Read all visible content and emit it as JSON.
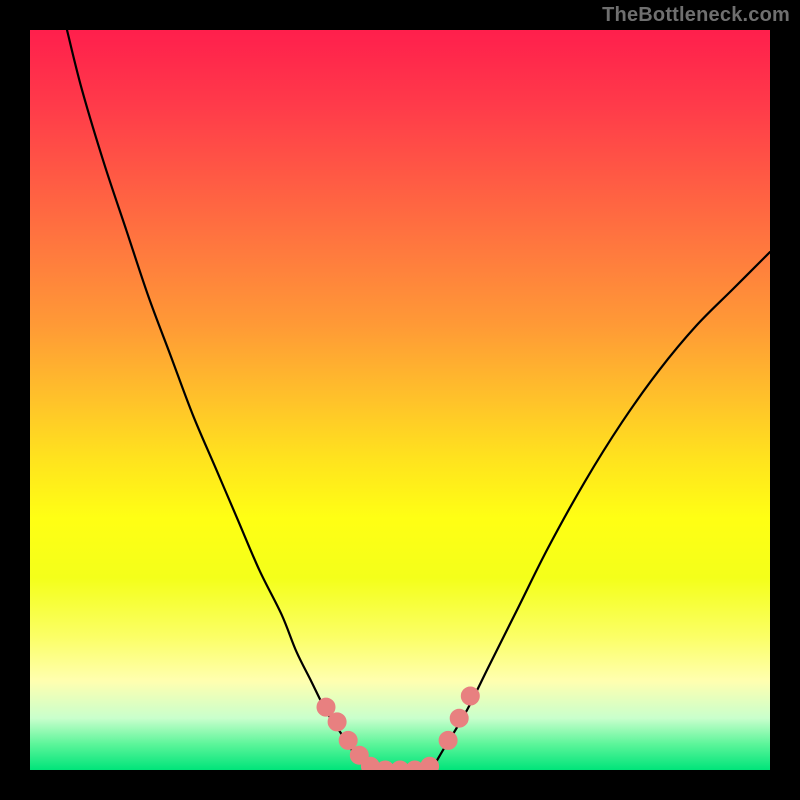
{
  "watermark": "TheBottleneck.com",
  "gradient": {
    "stops": [
      {
        "offset": 0.0,
        "color": "#ff1f4c"
      },
      {
        "offset": 0.1,
        "color": "#ff3a4a"
      },
      {
        "offset": 0.2,
        "color": "#ff5a44"
      },
      {
        "offset": 0.3,
        "color": "#ff7a3e"
      },
      {
        "offset": 0.4,
        "color": "#ff9a36"
      },
      {
        "offset": 0.5,
        "color": "#ffc22a"
      },
      {
        "offset": 0.58,
        "color": "#ffe31e"
      },
      {
        "offset": 0.66,
        "color": "#ffff14"
      },
      {
        "offset": 0.74,
        "color": "#f4ff1a"
      },
      {
        "offset": 0.82,
        "color": "#fbff66"
      },
      {
        "offset": 0.88,
        "color": "#ffffb0"
      },
      {
        "offset": 0.93,
        "color": "#c9ffcc"
      },
      {
        "offset": 0.965,
        "color": "#5cf59a"
      },
      {
        "offset": 1.0,
        "color": "#00e47a"
      }
    ]
  },
  "chart_data": {
    "type": "line",
    "title": "",
    "xlabel": "",
    "ylabel": "",
    "xlim": [
      0,
      100
    ],
    "ylim": [
      0,
      100
    ],
    "note": "Y-axis inverted visually (y=0 at bottom). Values are estimated from pixel positions.",
    "series": [
      {
        "name": "left-curve",
        "x": [
          5,
          7,
          10,
          13,
          16,
          19,
          22,
          25,
          28,
          31,
          34,
          36,
          38,
          40,
          42,
          44,
          46
        ],
        "y": [
          100,
          92,
          82,
          73,
          64,
          56,
          48,
          41,
          34,
          27,
          21,
          16,
          12,
          8,
          5,
          2,
          0
        ]
      },
      {
        "name": "flat-bottom",
        "x": [
          46,
          48,
          50,
          52,
          54
        ],
        "y": [
          0,
          0,
          0,
          0,
          0
        ]
      },
      {
        "name": "right-curve",
        "x": [
          54,
          56,
          59,
          62,
          66,
          70,
          75,
          80,
          85,
          90,
          95,
          100
        ],
        "y": [
          0,
          3,
          8,
          14,
          22,
          30,
          39,
          47,
          54,
          60,
          65,
          70
        ]
      }
    ],
    "highlight_markers": {
      "name": "salmon-dots",
      "color": "#e88080",
      "radius_px": 9,
      "points": [
        {
          "x": 40.0,
          "y": 8.5
        },
        {
          "x": 41.5,
          "y": 6.5
        },
        {
          "x": 43.0,
          "y": 4.0
        },
        {
          "x": 44.5,
          "y": 2.0
        },
        {
          "x": 46.0,
          "y": 0.5
        },
        {
          "x": 48.0,
          "y": 0.0
        },
        {
          "x": 50.0,
          "y": 0.0
        },
        {
          "x": 52.0,
          "y": 0.0
        },
        {
          "x": 54.0,
          "y": 0.5
        },
        {
          "x": 56.5,
          "y": 4.0
        },
        {
          "x": 58.0,
          "y": 7.0
        },
        {
          "x": 59.5,
          "y": 10.0
        }
      ]
    }
  }
}
